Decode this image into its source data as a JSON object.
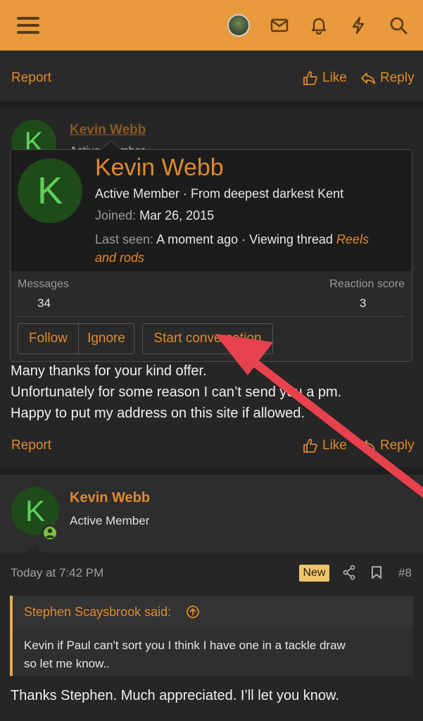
{
  "topbar": {
    "menu_icon": "hamburger-icon",
    "icons": [
      "avatar",
      "envelope-icon",
      "bell-icon",
      "lightning-icon",
      "search-icon"
    ]
  },
  "post_prev": {
    "report": "Report",
    "like": "Like",
    "reply": "Reply"
  },
  "post7": {
    "author": "Kevin Webb",
    "role_partial": "Active Member",
    "avatar_letter": "K",
    "body": [
      "Many thanks for your kind offer.",
      "Unfortunately for some reason I can’t send you a pm.",
      "Happy to put my address on this site if allowed."
    ],
    "report": "Report",
    "like": "Like",
    "reply": "Reply"
  },
  "popup": {
    "avatar_letter": "K",
    "name": "Kevin Webb",
    "subtitle": "Active Member · From deepest darkest Kent",
    "joined_label": "Joined:",
    "joined_value": "Mar 26, 2015",
    "last_seen_label": "Last seen:",
    "last_seen_value": "A moment ago · Viewing thread",
    "thread_link_1": "Reels",
    "thread_link_2": "and rods",
    "messages_label": "Messages",
    "messages_value": "34",
    "reaction_label": "Reaction score",
    "reaction_value": "3",
    "follow": "Follow",
    "ignore": "Ignore",
    "start_conversation": "Start conversation"
  },
  "post8": {
    "avatar_letter": "K",
    "author": "Kevin Webb",
    "role": "Active Member",
    "timestamp": "Today at 7:42 PM",
    "badge": "New",
    "number": "#8",
    "quote_author": "Stephen Scaysbrook said:",
    "quote_text_1": "Kevin if Paul can't sort you I think I have one in a tackle draw",
    "quote_text_2": "so let me know..",
    "body": "Thanks Stephen. Much appreciated. I’ll let you know."
  },
  "colors": {
    "accent": "#e08a2e",
    "topbar": "#e89a3c",
    "annotation_arrow": "#e8414e"
  }
}
